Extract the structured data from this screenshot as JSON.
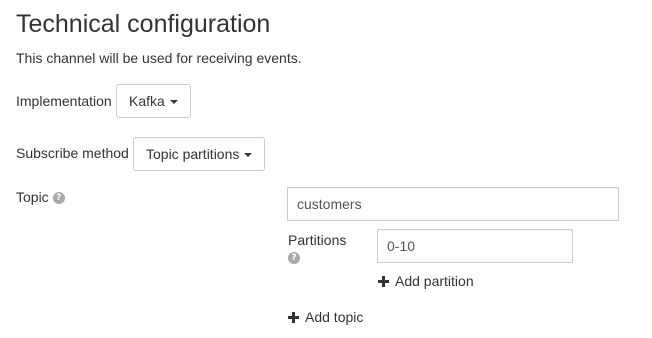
{
  "header": {
    "title": "Technical configuration",
    "subtitle": "This channel will be used for receiving events."
  },
  "implementation": {
    "label": "Implementation",
    "selected": "Kafka"
  },
  "subscribe_method": {
    "label": "Subscribe method",
    "selected": "Topic partitions"
  },
  "topic": {
    "label": "Topic",
    "help_glyph": "?",
    "value": "customers",
    "add_topic_label": "Add topic"
  },
  "partitions": {
    "label": "Partitions",
    "help_glyph": "?",
    "value": "0-10",
    "add_partition_label": "Add partition"
  },
  "icons": {
    "help": "question-circle-icon",
    "add": "plus-icon",
    "dropdown": "caret-down-icon"
  },
  "colors": {
    "text": "#333333",
    "border": "#cccccc",
    "help_icon": "#a8a8a8"
  }
}
